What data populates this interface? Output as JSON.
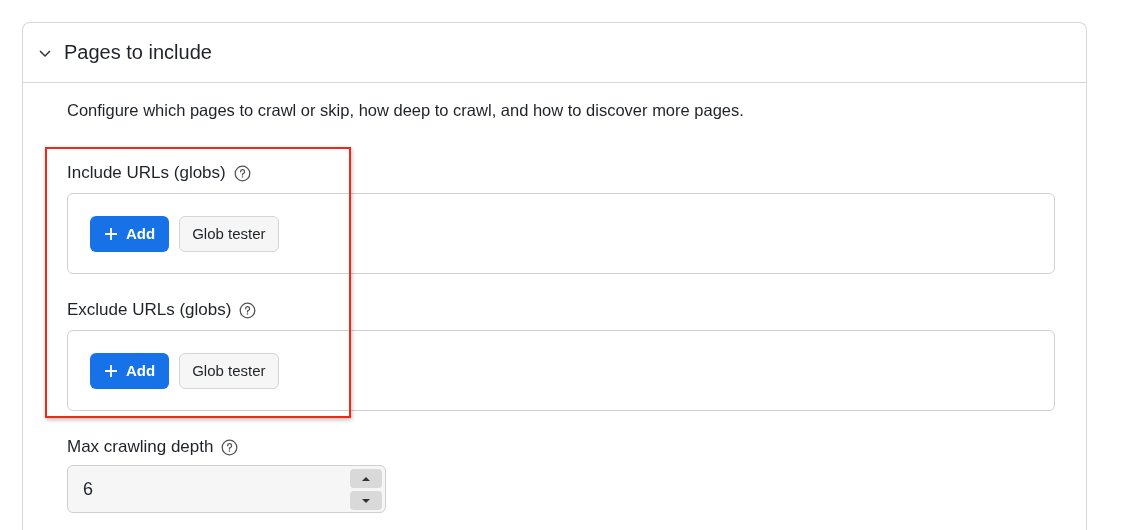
{
  "section": {
    "title": "Pages to include",
    "expanded": true,
    "description": "Configure which pages to crawl or skip, how deep to crawl, and how to discover more pages."
  },
  "glob_fields": [
    {
      "label": "Include URLs (globs)",
      "add_button": "Add",
      "tester_button": "Glob tester"
    },
    {
      "label": "Exclude URLs (globs)",
      "add_button": "Add",
      "tester_button": "Glob tester"
    }
  ],
  "depth_field": {
    "label": "Max crawling depth",
    "value": "6"
  },
  "highlight": {
    "kind": "frame"
  }
}
